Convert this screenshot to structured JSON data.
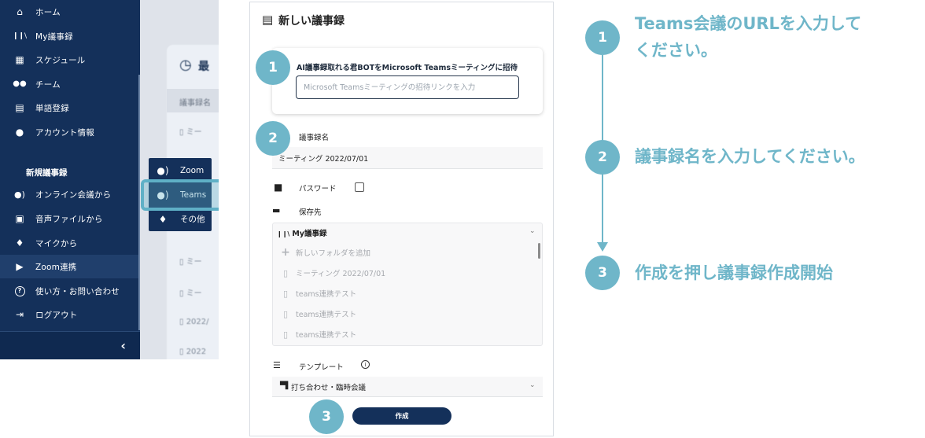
{
  "sidebar": {
    "items": [
      {
        "label": "ホーム",
        "icon": "home-icon",
        "glyph": "⌂"
      },
      {
        "label": "My議事録",
        "icon": "library-icon",
        "glyph": "❙❙\\"
      },
      {
        "label": "スケジュール",
        "icon": "calendar-icon",
        "glyph": "▦"
      },
      {
        "label": "チーム",
        "icon": "team-icon",
        "glyph": "👥"
      },
      {
        "label": "単語登録",
        "icon": "book-icon",
        "glyph": "▤"
      },
      {
        "label": "アカウント情報",
        "icon": "account-icon",
        "glyph": "●"
      }
    ],
    "section_label": "新規議事録",
    "new_items": [
      {
        "label": "オンライン会議から",
        "icon": "online-meeting-icon",
        "glyph": "☊"
      },
      {
        "label": "音声ファイルから",
        "icon": "audio-file-icon",
        "glyph": "▣"
      },
      {
        "label": "マイクから",
        "icon": "microphone-icon",
        "glyph": "🎙"
      },
      {
        "label": "Zoom連携",
        "icon": "zoom-icon",
        "glyph": "▶"
      },
      {
        "label": "使い方・お問い合わせ",
        "icon": "help-icon",
        "glyph": "?"
      },
      {
        "label": "ログアウト",
        "icon": "logout-icon",
        "glyph": "⇥"
      }
    ]
  },
  "background": {
    "title": "最",
    "header": "議事録名",
    "rows": [
      "ミー",
      "ミー",
      "ミー",
      "ミー",
      "2022/",
      "2022"
    ]
  },
  "flyout": {
    "items": [
      {
        "label": "Zoom",
        "icon": "person-voice-icon"
      },
      {
        "label": "Teams",
        "icon": "person-voice-icon"
      },
      {
        "label": "その他",
        "icon": "microphone-icon"
      }
    ]
  },
  "form": {
    "title": "新しい議事録",
    "invite_label": "AI議事録取れる君BOTをMicrosoft Teamsミーティングに招待",
    "invite_placeholder": "Microsoft Teamsミーティングの招待リンクを入力",
    "name_label": "議事録名",
    "name_value": "ミーティング 2022/07/01",
    "password_label": "パスワード",
    "save_label": "保存先",
    "folder_header": "My議事録",
    "folder_rows": [
      {
        "label": "新しいフォルダを追加",
        "glyph": "+"
      },
      {
        "label": "ミーティング 2022/07/01",
        "glyph": "▯"
      },
      {
        "label": "teams連携テスト",
        "glyph": "▯"
      },
      {
        "label": "teams連携テスト",
        "glyph": "▯"
      },
      {
        "label": "teams連携テスト",
        "glyph": "▯"
      }
    ],
    "template_label": "テンプレート",
    "template_value": "打ち合わせ・臨時会議",
    "create_label": "作成"
  },
  "steps": [
    {
      "number": "1",
      "text_line1": "Teams会議のURLを入力して",
      "text_line2": "ください。"
    },
    {
      "number": "2",
      "text_line1": "議事録名を入力してください。"
    },
    {
      "number": "3",
      "text_line1": "作成を押し議事録作成開始"
    }
  ],
  "colors": {
    "sidebar_bg": "#14305a",
    "accent_teal": "#6fb6c9",
    "highlight_border": "#5fb0c6",
    "button_bg": "#14305a"
  }
}
